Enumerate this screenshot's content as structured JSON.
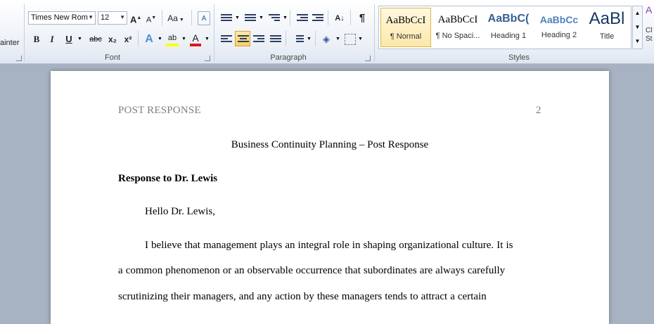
{
  "ribbon": {
    "clipboard": {
      "painter_label": "ainter"
    },
    "font": {
      "group_label": "Font",
      "font_name": "Times New Rom",
      "font_size": "12",
      "grow": "A",
      "shrink": "A",
      "change_case": "Aa",
      "bold": "B",
      "italic": "I",
      "underline": "U",
      "strikethrough": "abc",
      "subscript": "x₂",
      "superscript": "x²",
      "text_effects": "A",
      "highlight": "ab",
      "font_color": "A"
    },
    "paragraph": {
      "group_label": "Paragraph",
      "pilcrow": "¶",
      "sort": "A↓"
    },
    "styles": {
      "group_label": "Styles",
      "items": [
        {
          "preview": "AaBbCcI",
          "name": "¶ Normal"
        },
        {
          "preview": "AaBbCcI",
          "name": "¶ No Spaci..."
        },
        {
          "preview": "AaBbC(",
          "name": "Heading 1"
        },
        {
          "preview": "AaBbCc",
          "name": "Heading 2"
        },
        {
          "preview": "AaBl",
          "name": "Title"
        }
      ],
      "change_styles_label": "Cl St"
    },
    "accent_color": "#f8cf65"
  },
  "document": {
    "running_head": "POST RESPONSE",
    "page_number": "2",
    "title": "Business Continuity Planning – Post Response",
    "heading": "Response to Dr. Lewis",
    "greeting": "Hello Dr. Lewis,",
    "lines": [
      "I believe that management plays an integral role in shaping organizational  culture. It is",
      "a common phenomenon or an observable  occurrence that subordinates are always carefully",
      "scrutinizing  their managers, and any action by these managers tends to attract a certain"
    ]
  }
}
